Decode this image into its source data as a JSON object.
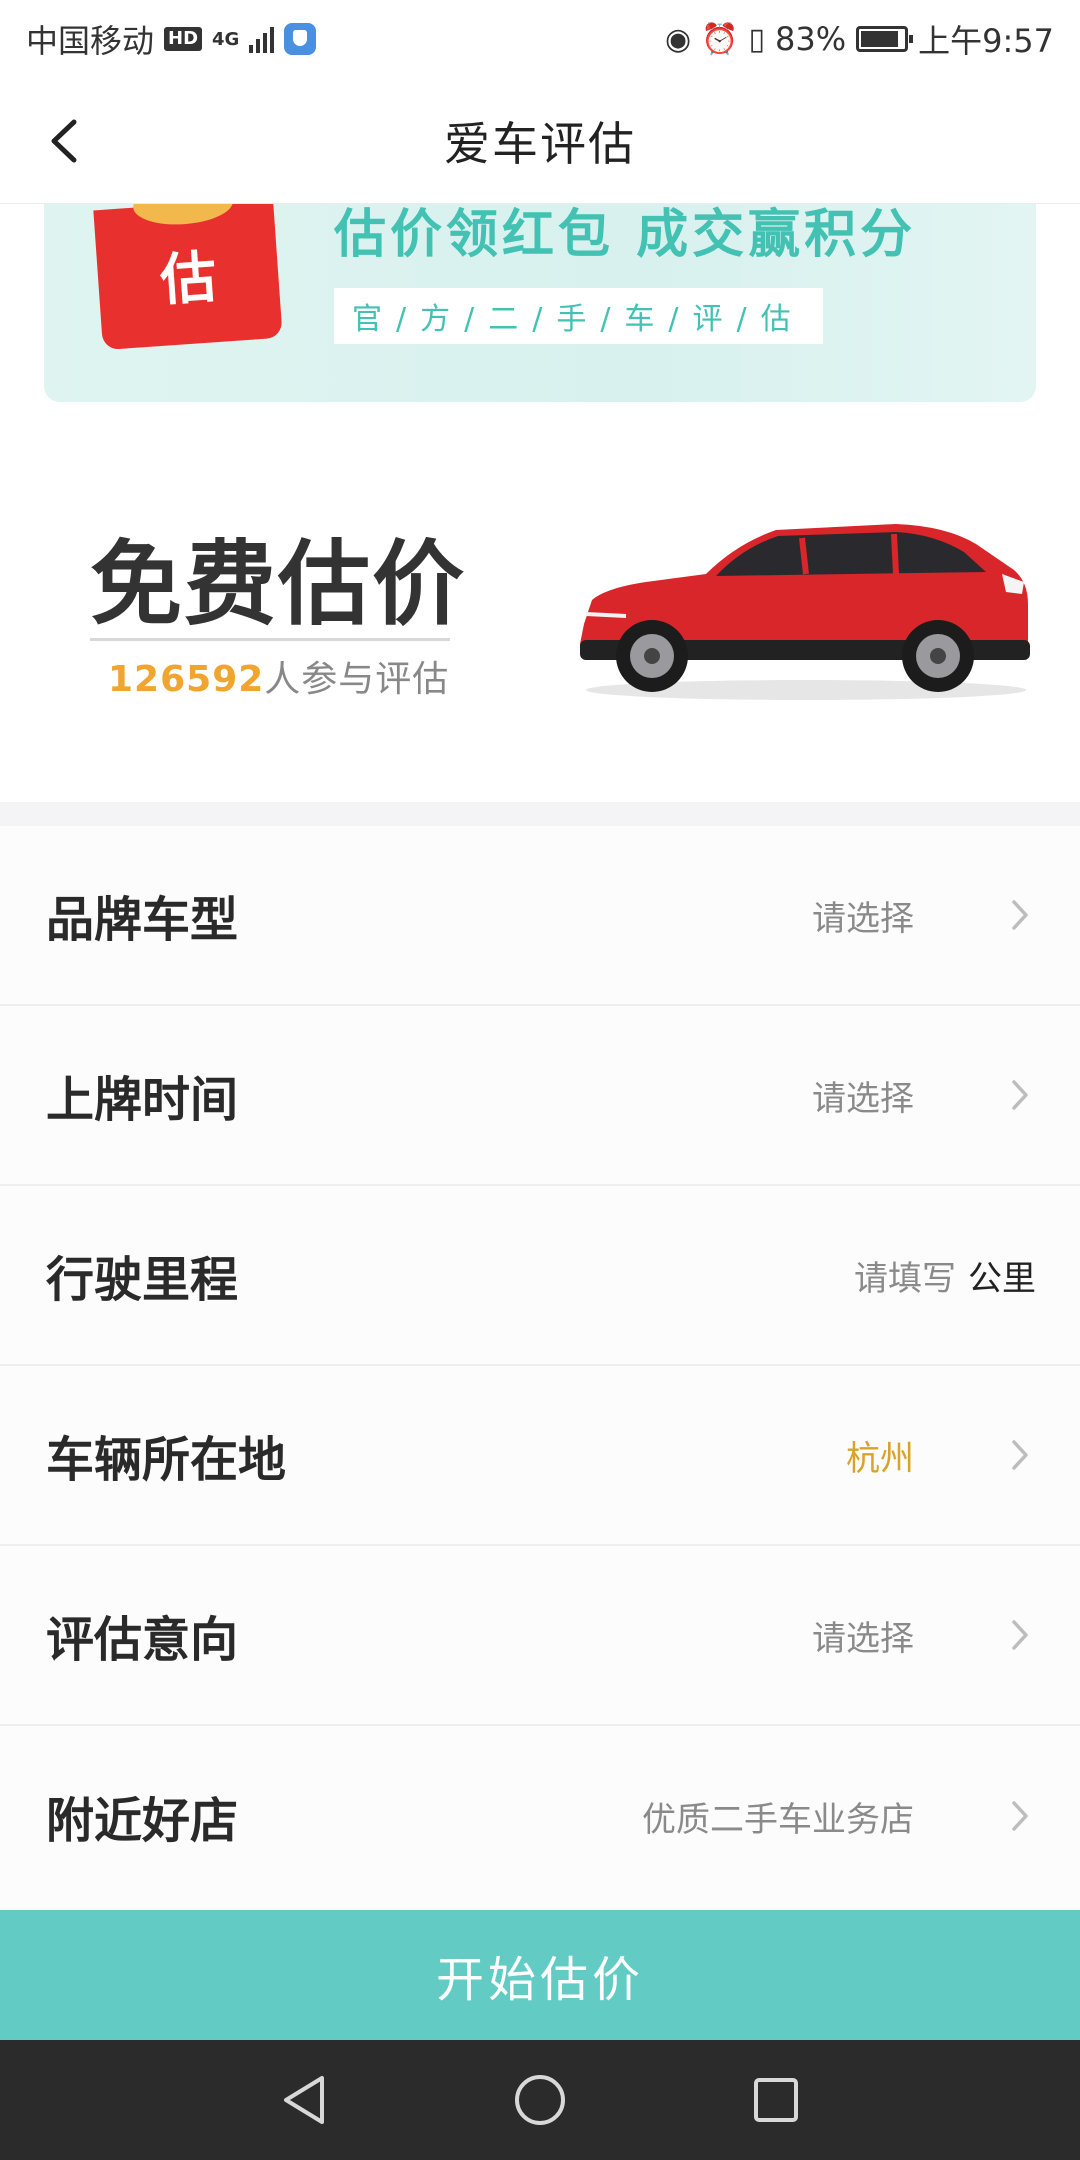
{
  "status_bar": {
    "carrier": "中国移动",
    "hd": "HD",
    "network": "4G",
    "battery": "83%",
    "time": "上午9:57"
  },
  "header": {
    "title": "爱车评估",
    "back_icon": "chevron-left-icon"
  },
  "banner": {
    "packet_label": "估",
    "title": "估价领红包 成交赢积分",
    "subtitle": "官/方/二/手/车/评/估"
  },
  "hero": {
    "title": "免费估价",
    "count": "126592",
    "count_suffix": "人参与评估"
  },
  "form": {
    "rows": [
      {
        "label": "品牌车型",
        "value": "请选择"
      },
      {
        "label": "上牌时间",
        "value": "请选择"
      },
      {
        "label": "行驶里程",
        "placeholder": "请填写",
        "unit": "公里"
      },
      {
        "label": "车辆所在地",
        "value": "杭州"
      },
      {
        "label": "评估意向",
        "value": "请选择"
      },
      {
        "label": "附近好店",
        "value": "优质二手车业务店"
      }
    ]
  },
  "submit": {
    "label": "开始估价"
  },
  "colors": {
    "accent": "#62cbc3",
    "highlight": "#f0a52e",
    "location": "#dba22a",
    "banner_text": "#43c2b3"
  }
}
